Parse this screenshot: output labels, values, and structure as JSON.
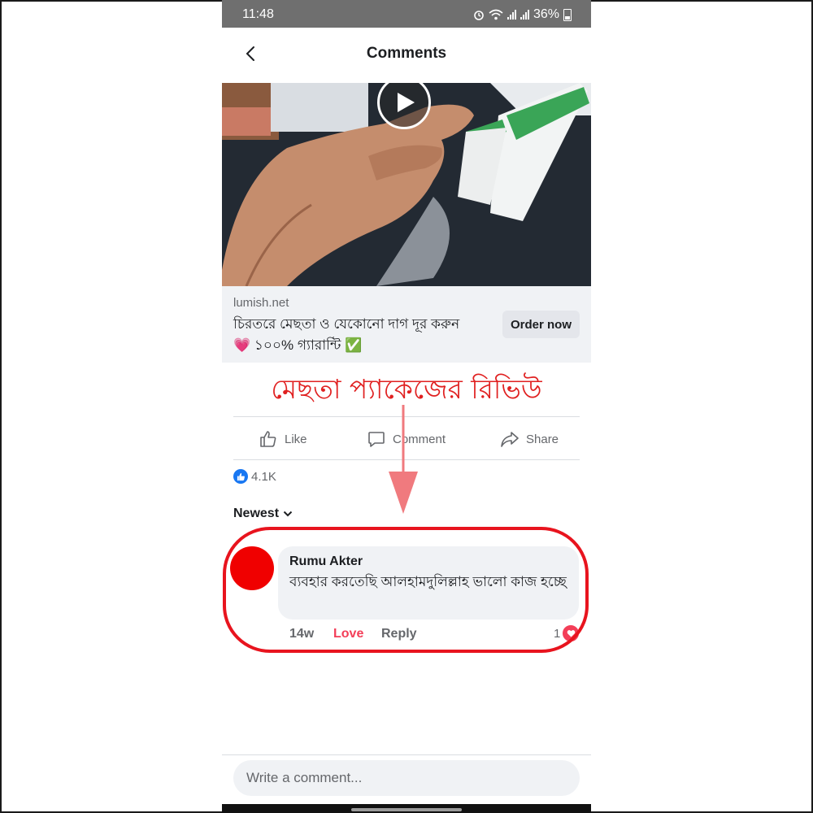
{
  "status_bar": {
    "time": "11:48",
    "battery": "36%"
  },
  "header": {
    "title": "Comments"
  },
  "ad": {
    "domain": "lumish.net",
    "headline_line1": "চিরতরে মেছতা ও যেকোনো দাগ দূর করুন",
    "headline_line2": "💗 ১০০% গ্যারান্টি ✅",
    "cta_label": "Order now"
  },
  "overlay_caption": "মেছতা প্যাকেজের রিভিউ",
  "actions": {
    "like": "Like",
    "comment": "Comment",
    "share": "Share"
  },
  "reactions": {
    "count": "4.1K"
  },
  "sort": {
    "label": "Newest"
  },
  "comment": {
    "author": "Rumu Akter",
    "text": "ব্যবহার করতেছি আলহামদুলিল্লাহ ভালো কাজ হচ্ছে",
    "time": "14w",
    "reaction_label": "Love",
    "reply_label": "Reply",
    "reaction_count": "1"
  },
  "composer": {
    "placeholder": "Write a comment..."
  },
  "colors": {
    "annotation_red": "#e8141e",
    "love_pink": "#f33e58",
    "facebook_blue": "#1877f2",
    "status_bar_gray": "#6f6f6f"
  },
  "icons": [
    "back-icon",
    "play-icon",
    "like-icon",
    "comment-icon",
    "share-icon",
    "like-reaction-icon",
    "chevron-down-icon",
    "love-reaction-icon",
    "wifi-icon",
    "alarm-icon",
    "battery-icon"
  ]
}
